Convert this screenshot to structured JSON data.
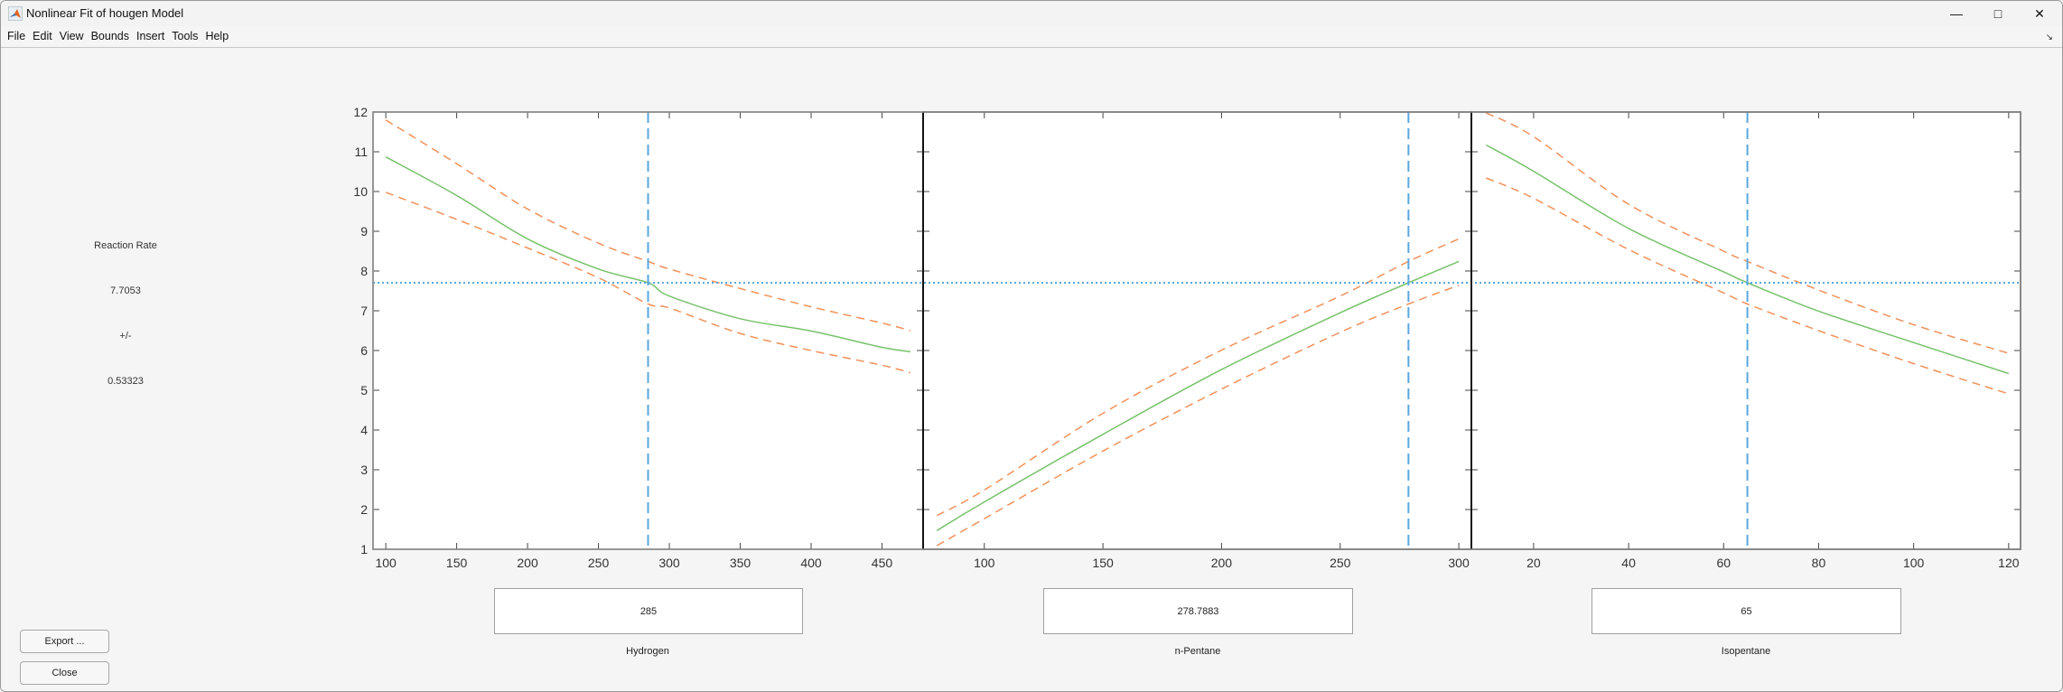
{
  "window": {
    "title": "Nonlinear Fit of hougen Model",
    "controls": [
      "minimize-icon",
      "maximize-icon",
      "close-icon"
    ]
  },
  "menu": [
    "File",
    "Edit",
    "View",
    "Bounds",
    "Insert",
    "Tools",
    "Help"
  ],
  "response": {
    "label": "Reaction Rate",
    "value": "7.7053",
    "pm": "+/-",
    "halfwidth": "0.53323"
  },
  "buttons": {
    "export": "Export ...",
    "close": "Close"
  },
  "colors": {
    "fit": "#77c26b",
    "bounds": "#f0915a",
    "crosshair": "#5aa7de",
    "axis": "#333333"
  },
  "chart_data": {
    "type": "line",
    "ylim": [
      1,
      12
    ],
    "yticks": [
      1,
      2,
      3,
      4,
      5,
      6,
      7,
      8,
      9,
      10,
      11,
      12
    ],
    "current_y": 7.7053,
    "grid": false,
    "panels": [
      {
        "xlabel": "Hydrogen",
        "current_x": "285",
        "current_x_value": 285,
        "xlim": [
          91,
          479
        ],
        "xticks": [
          100,
          150,
          200,
          250,
          300,
          350,
          400,
          450
        ],
        "x": [
          100,
          150,
          200,
          250,
          285,
          300,
          350,
          400,
          450,
          470
        ],
        "fit": [
          10.87,
          9.9,
          8.81,
          8.05,
          7.705,
          7.37,
          6.8,
          6.49,
          6.08,
          5.97
        ],
        "upper": [
          11.8,
          10.7,
          9.56,
          8.7,
          8.24,
          8.05,
          7.56,
          7.1,
          6.69,
          6.5
        ],
        "lower": [
          9.98,
          9.3,
          8.58,
          7.83,
          7.17,
          7.07,
          6.43,
          6.0,
          5.63,
          5.44
        ]
      },
      {
        "xlabel": "n-Pentane",
        "current_x": "278.7883",
        "current_x_value": 278.7883,
        "xlim": [
          74.2,
          305.3
        ],
        "xticks": [
          100,
          150,
          200,
          250,
          300
        ],
        "x": [
          80,
          100,
          150,
          200,
          250,
          278.79,
          300
        ],
        "fit": [
          1.47,
          2.19,
          3.89,
          5.52,
          6.95,
          7.705,
          8.24
        ],
        "upper": [
          1.85,
          2.49,
          4.42,
          6.01,
          7.37,
          8.24,
          8.81
        ],
        "lower": [
          1.09,
          1.77,
          3.47,
          5.03,
          6.46,
          7.17,
          7.64
        ]
      },
      {
        "xlabel": "Isopentane",
        "current_x": "65",
        "current_x_value": 65,
        "xlim": [
          6.9,
          122.5
        ],
        "xticks": [
          20,
          40,
          60,
          80,
          100,
          120
        ],
        "x": [
          10,
          20,
          40,
          60,
          65,
          80,
          100,
          120
        ],
        "fit": [
          11.17,
          10.51,
          9.07,
          7.98,
          7.705,
          6.99,
          6.2,
          5.42
        ],
        "upper": [
          11.98,
          11.38,
          9.68,
          8.5,
          8.24,
          7.52,
          6.65,
          5.93
        ],
        "lower": [
          10.34,
          9.83,
          8.54,
          7.45,
          7.17,
          6.5,
          5.67,
          4.91
        ]
      }
    ]
  }
}
